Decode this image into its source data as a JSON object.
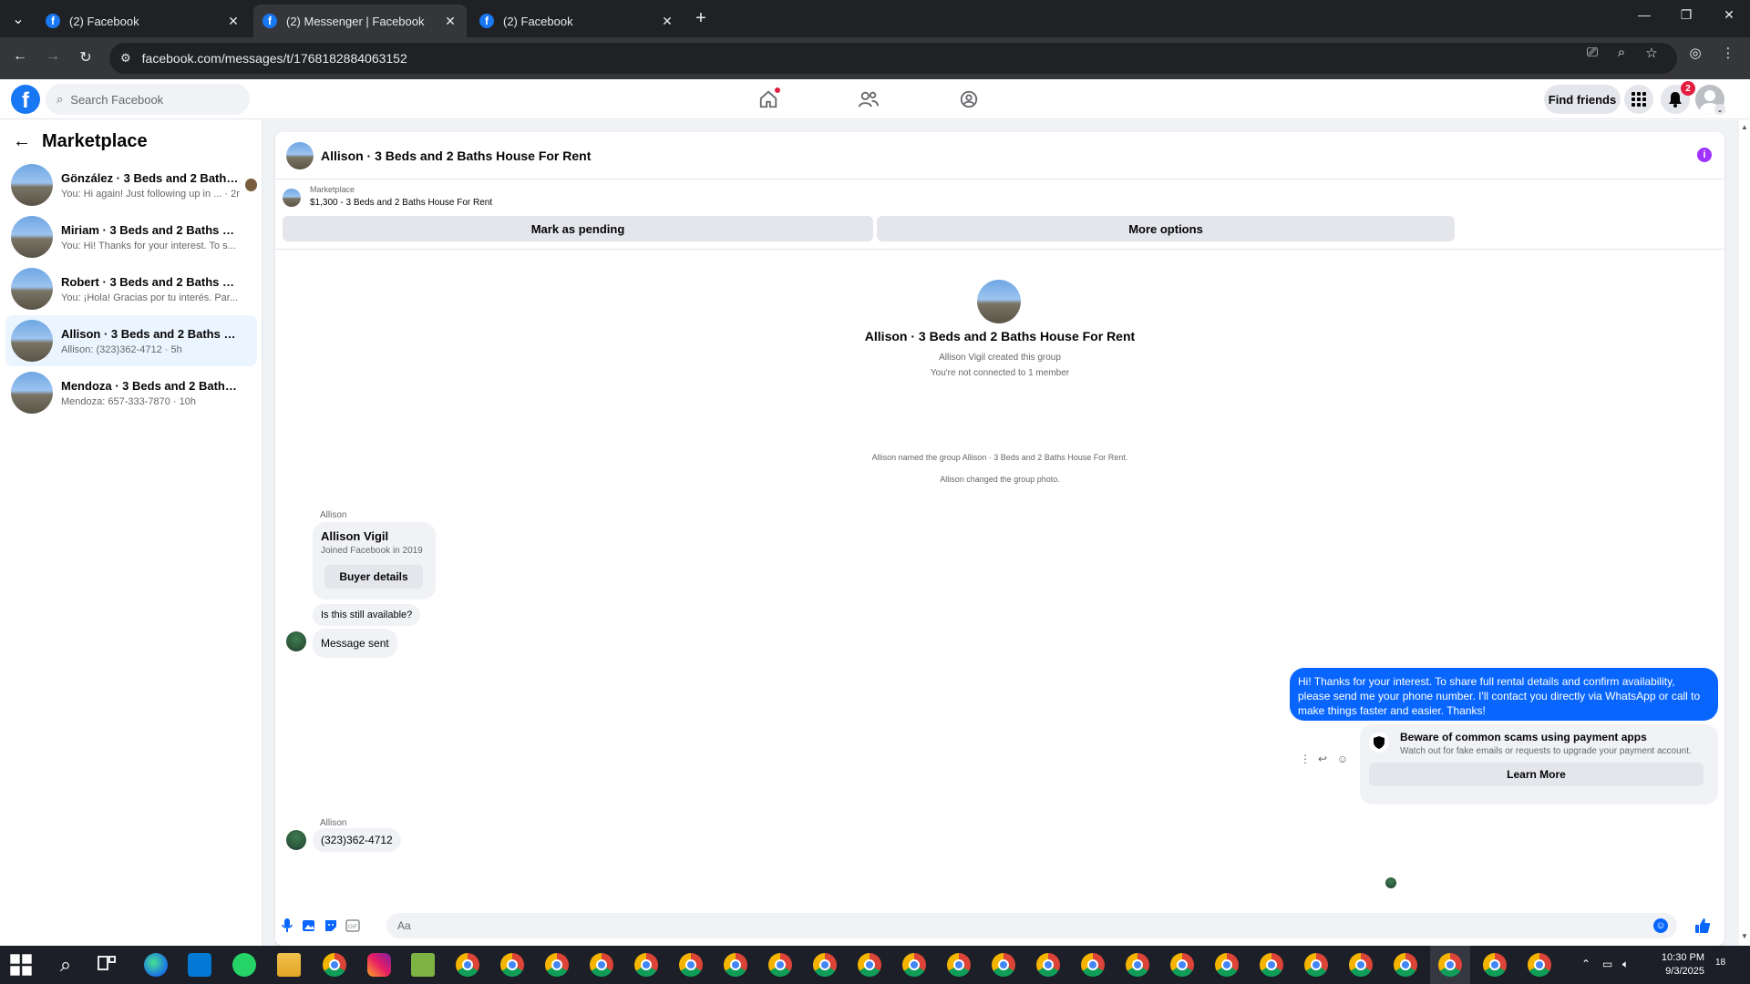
{
  "browser": {
    "tabs": [
      {
        "title": "(2) Facebook"
      },
      {
        "title": "(2) Messenger | Facebook"
      },
      {
        "title": "(2) Facebook"
      }
    ],
    "url": "facebook.com/messages/t/1768182884063152"
  },
  "fb_header": {
    "search_placeholder": "Search Facebook",
    "find_friends_label": "Find friends",
    "notification_count": "2"
  },
  "sidebar": {
    "title": "Marketplace",
    "conversations": [
      {
        "name": "Gönzález · 3 Beds and 2 Baths H...",
        "preview": "You: Hi again! Just following up in ... · 2m"
      },
      {
        "name": "Miriam · 3 Beds and 2 Baths Hous...",
        "preview": "You: Hi! Thanks for your interest. To s... · 2m"
      },
      {
        "name": "Robert · 3 Beds and 2 Baths House...",
        "preview": "You: ¡Hola! Gracias por tu interés. Par... · 3m"
      },
      {
        "name": "Allison · 3 Beds and 2 Baths House...",
        "preview": "Allison: (323)362-4712 · 5h"
      },
      {
        "name": "Mendoza · 3 Beds and 2 Baths Ho...",
        "preview": "Mendoza: 657-333-7870 · 10h"
      }
    ]
  },
  "chat": {
    "title": "Allison · 3 Beds and 2 Baths House For Rent",
    "listing": {
      "label": "Marketplace",
      "price_title": "$1,300 - 3 Beds and 2 Baths House For Rent"
    },
    "actions": {
      "mark_pending": "Mark as pending",
      "more_options": "More options"
    },
    "group_intro": {
      "name": "Allison · 3 Beds and 2 Baths House For Rent",
      "created": "Allison Vigil created this group",
      "connection": "You're not connected to 1 member"
    },
    "system_messages": [
      "Allison named the group Allison · 3 Beds and 2 Baths House For Rent.",
      "Allison changed the group photo."
    ],
    "buyer_card": {
      "sender": "Allison",
      "name": "Allison Vigil",
      "joined": "Joined Facebook in 2019",
      "button": "Buyer details"
    },
    "incoming_1": "Is this still available?",
    "incoming_2": "Message sent",
    "outgoing": "Hi! Thanks for your interest. To share full rental details and confirm availability, please send me your phone number. I'll contact you directly via WhatsApp or call to make things faster and easier. Thanks!",
    "scam_notice": {
      "title": "Beware of common scams using payment apps",
      "subtitle": "Watch out for fake emails or requests to upgrade your payment account.",
      "button": "Learn More"
    },
    "last_sender": "Allison",
    "last_message": "(323)362-4712",
    "composer_placeholder": "Aa"
  },
  "taskbar": {
    "time": "10:30 PM",
    "date": "9/3/2025",
    "notif_count": "18"
  },
  "colors": {
    "fb_blue": "#1877f2",
    "messenger_blue": "#0866ff",
    "info_purple": "#a033ff",
    "badge_red": "#e41e3f"
  }
}
